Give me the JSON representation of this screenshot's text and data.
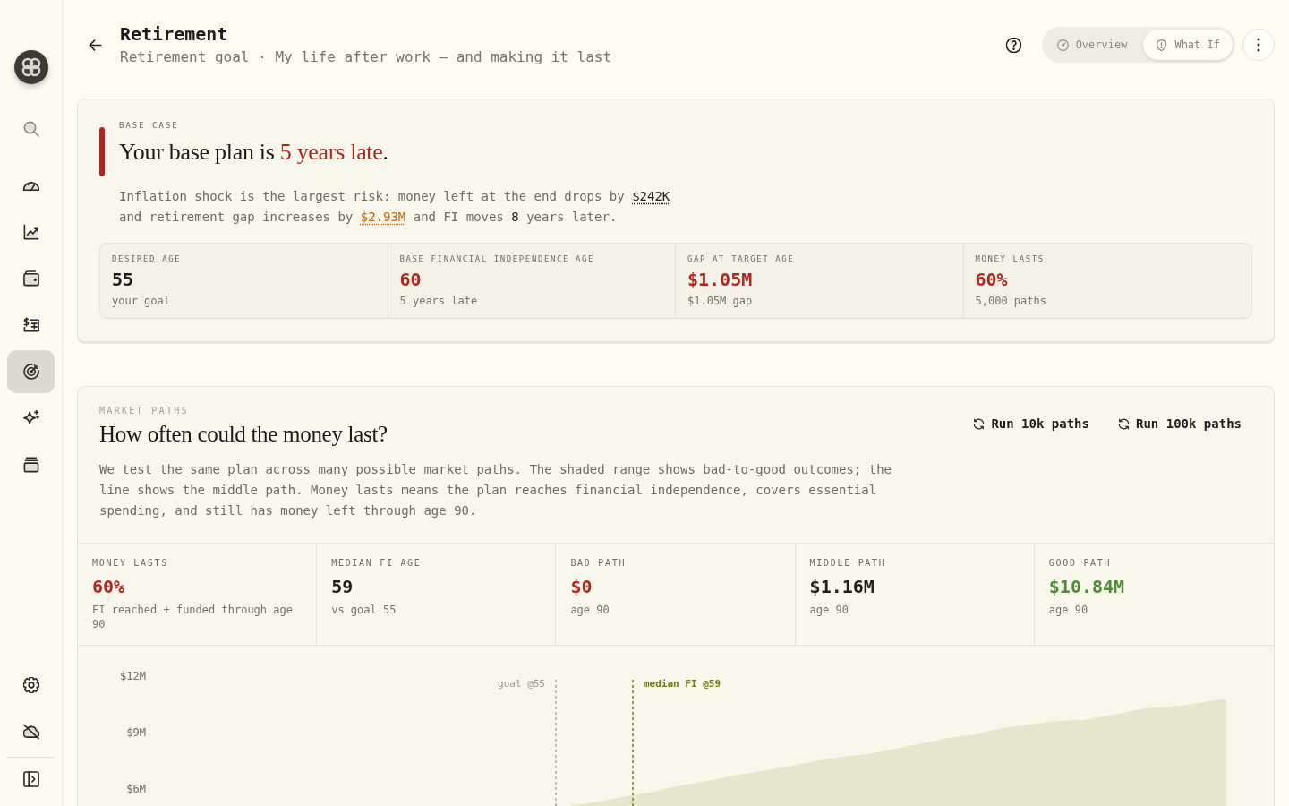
{
  "sidebar": {
    "items": [
      {
        "selected": false
      },
      {
        "selected": false
      },
      {
        "selected": false
      },
      {
        "selected": false
      },
      {
        "selected": false
      },
      {
        "selected": true
      },
      {
        "selected": false
      },
      {
        "selected": false
      }
    ]
  },
  "header": {
    "title": "Retirement",
    "subtitle": "Retirement goal · My life after work — and making it last",
    "tabs": [
      {
        "label": "Overview",
        "selected": false
      },
      {
        "label": "What If",
        "selected": true
      }
    ]
  },
  "base_case": {
    "eyebrow": "BASE CASE",
    "headline": [
      {
        "kind": "text",
        "text": "Your base plan is "
      },
      {
        "kind": "alert",
        "text": "5 years late"
      },
      {
        "kind": "text",
        "text": "."
      }
    ],
    "summary": [
      {
        "kind": "text",
        "text": "Inflation shock is the largest risk: money left at the end drops by "
      },
      {
        "kind": "figure",
        "text": "$242K"
      },
      {
        "kind": "text",
        "text": " and retirement gap increases by "
      },
      {
        "kind": "warning_figure",
        "text": "$2.93M"
      },
      {
        "kind": "text",
        "text": " and FI moves "
      },
      {
        "kind": "number",
        "text": "8"
      },
      {
        "kind": "text",
        "text": " years later."
      }
    ],
    "stats": [
      {
        "label": "DESIRED AGE",
        "value": "55",
        "color": "#1f1d18",
        "note": "your goal"
      },
      {
        "label": "BASE FINANCIAL INDEPENDENCE AGE",
        "value": "60",
        "color": "#b0261f",
        "note": "5 years late"
      },
      {
        "label": "GAP AT TARGET AGE",
        "value": "$1.05M",
        "color": "#b0261f",
        "note": "$1.05M gap"
      },
      {
        "label": "MONEY LASTS",
        "value": "60%",
        "color": "#b0261f",
        "note": "5,000 paths"
      }
    ]
  },
  "market_paths": {
    "eyebrow": "MARKET PATHS",
    "title": "How often could the money last?",
    "actions": [
      "Run 10k paths",
      "Run 100k paths"
    ],
    "description": "We test the same plan across many possible market paths. The shaded range shows bad-to-good outcomes; the line shows the middle path. Money lasts means the plan reaches financial independence, covers essential spending, and still has money left through age 90.",
    "stats": [
      {
        "label": "MONEY LASTS",
        "value": "60%",
        "color": "#b0261f",
        "note": "FI reached + funded through age 90"
      },
      {
        "label": "MEDIAN FI AGE",
        "value": "59",
        "color": "#1f1d18",
        "note": "vs goal 55"
      },
      {
        "label": "BAD PATH",
        "value": "$0",
        "color": "#b0261f",
        "note": "age 90"
      },
      {
        "label": "MIDDLE PATH",
        "value": "$1.16M",
        "color": "#1f1d18",
        "note": "age 90"
      },
      {
        "label": "GOOD PATH",
        "value": "$10.84M",
        "color": "#4f8a3a",
        "note": "age 90"
      }
    ],
    "chart": {
      "y_axis_labels": [
        "$12M",
        "$9M",
        "$6M"
      ],
      "markers": [
        {
          "kind": "goal",
          "label": "goal @55"
        },
        {
          "kind": "median",
          "label": "median FI @59"
        }
      ]
    }
  }
}
